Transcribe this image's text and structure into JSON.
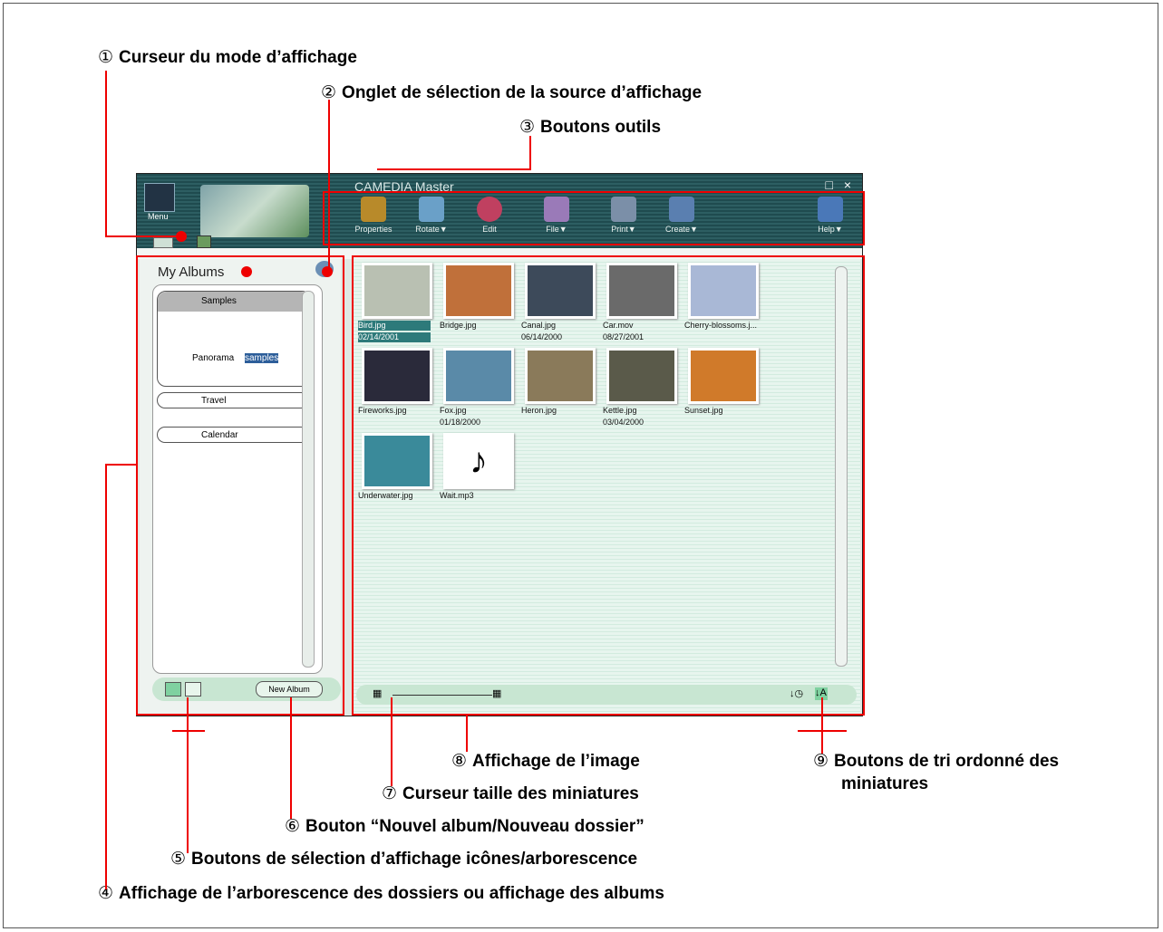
{
  "callouts": [
    {
      "num": "①",
      "text": "Curseur du mode d’affichage"
    },
    {
      "num": "②",
      "text": "Onglet de sélection de la source d’affichage"
    },
    {
      "num": "③",
      "text": "Boutons outils"
    },
    {
      "num": "④",
      "text": "Affichage de l’arborescence des dossiers ou affichage des  albums"
    },
    {
      "num": "⑤",
      "text": "Boutons de sélection d’affichage icônes/arborescence"
    },
    {
      "num": "⑥",
      "text": "Bouton “Nouvel album/Nouveau dossier”"
    },
    {
      "num": "⑦",
      "text": "Curseur taille des miniatures"
    },
    {
      "num": "⑧",
      "text": "Affichage de l’image"
    },
    {
      "num": "⑨",
      "text": "Boutons de tri ordonné des",
      "text2": "miniatures"
    }
  ],
  "app": {
    "title": "CAMEDIA Master",
    "window_controls": "_ □ ×",
    "menu_label": "Menu",
    "tools": [
      {
        "label": "Properties",
        "color": "#b88a2a"
      },
      {
        "label": "Rotate▼",
        "color": "#6aa0c8"
      },
      {
        "label": "Edit",
        "color": "#c04060"
      },
      {
        "label": "File▼",
        "color": "#9a7ab8"
      },
      {
        "label": "Print▼",
        "color": "#7b8fa8"
      },
      {
        "label": "Create▼",
        "color": "#5a7fb0"
      },
      {
        "label": "Help▼",
        "color": "#4a78b8"
      }
    ]
  },
  "left_pane": {
    "tab_label": "My Albums",
    "group": {
      "label": "Samples",
      "items": [
        "Panorama",
        "samples"
      ]
    },
    "albums": [
      "Travel",
      "Calendar"
    ],
    "new_album": "New Album"
  },
  "thumbnails": [
    {
      "name": "Bird.jpg",
      "date": "02/14/2001",
      "color": "#b9c0b2",
      "selected": true
    },
    {
      "name": "Bridge.jpg",
      "date": "",
      "color": "#c0703a"
    },
    {
      "name": "Canal.jpg",
      "date": "06/14/2000",
      "color": "#3d4a5a"
    },
    {
      "name": "Car.mov",
      "date": "08/27/2001",
      "color": "#6a6a6a"
    },
    {
      "name": "Cherry-blossoms.j...",
      "date": "",
      "color": "#a9b8d6"
    },
    {
      "name": "Fireworks.jpg",
      "date": "",
      "color": "#2a2a3a"
    },
    {
      "name": "Fox.jpg",
      "date": "01/18/2000",
      "color": "#5a8aa8"
    },
    {
      "name": "Heron.jpg",
      "date": "",
      "color": "#8a7a5a"
    },
    {
      "name": "Kettle.jpg",
      "date": "03/04/2000",
      "color": "#5a5a4a"
    },
    {
      "name": "Sunset.jpg",
      "date": "",
      "color": "#d07a2a"
    },
    {
      "name": "Underwater.jpg",
      "date": "",
      "color": "#3a8a9a"
    },
    {
      "name": "Wait.mp3",
      "date": "",
      "color": "#ffffff",
      "icon": "♪"
    }
  ]
}
